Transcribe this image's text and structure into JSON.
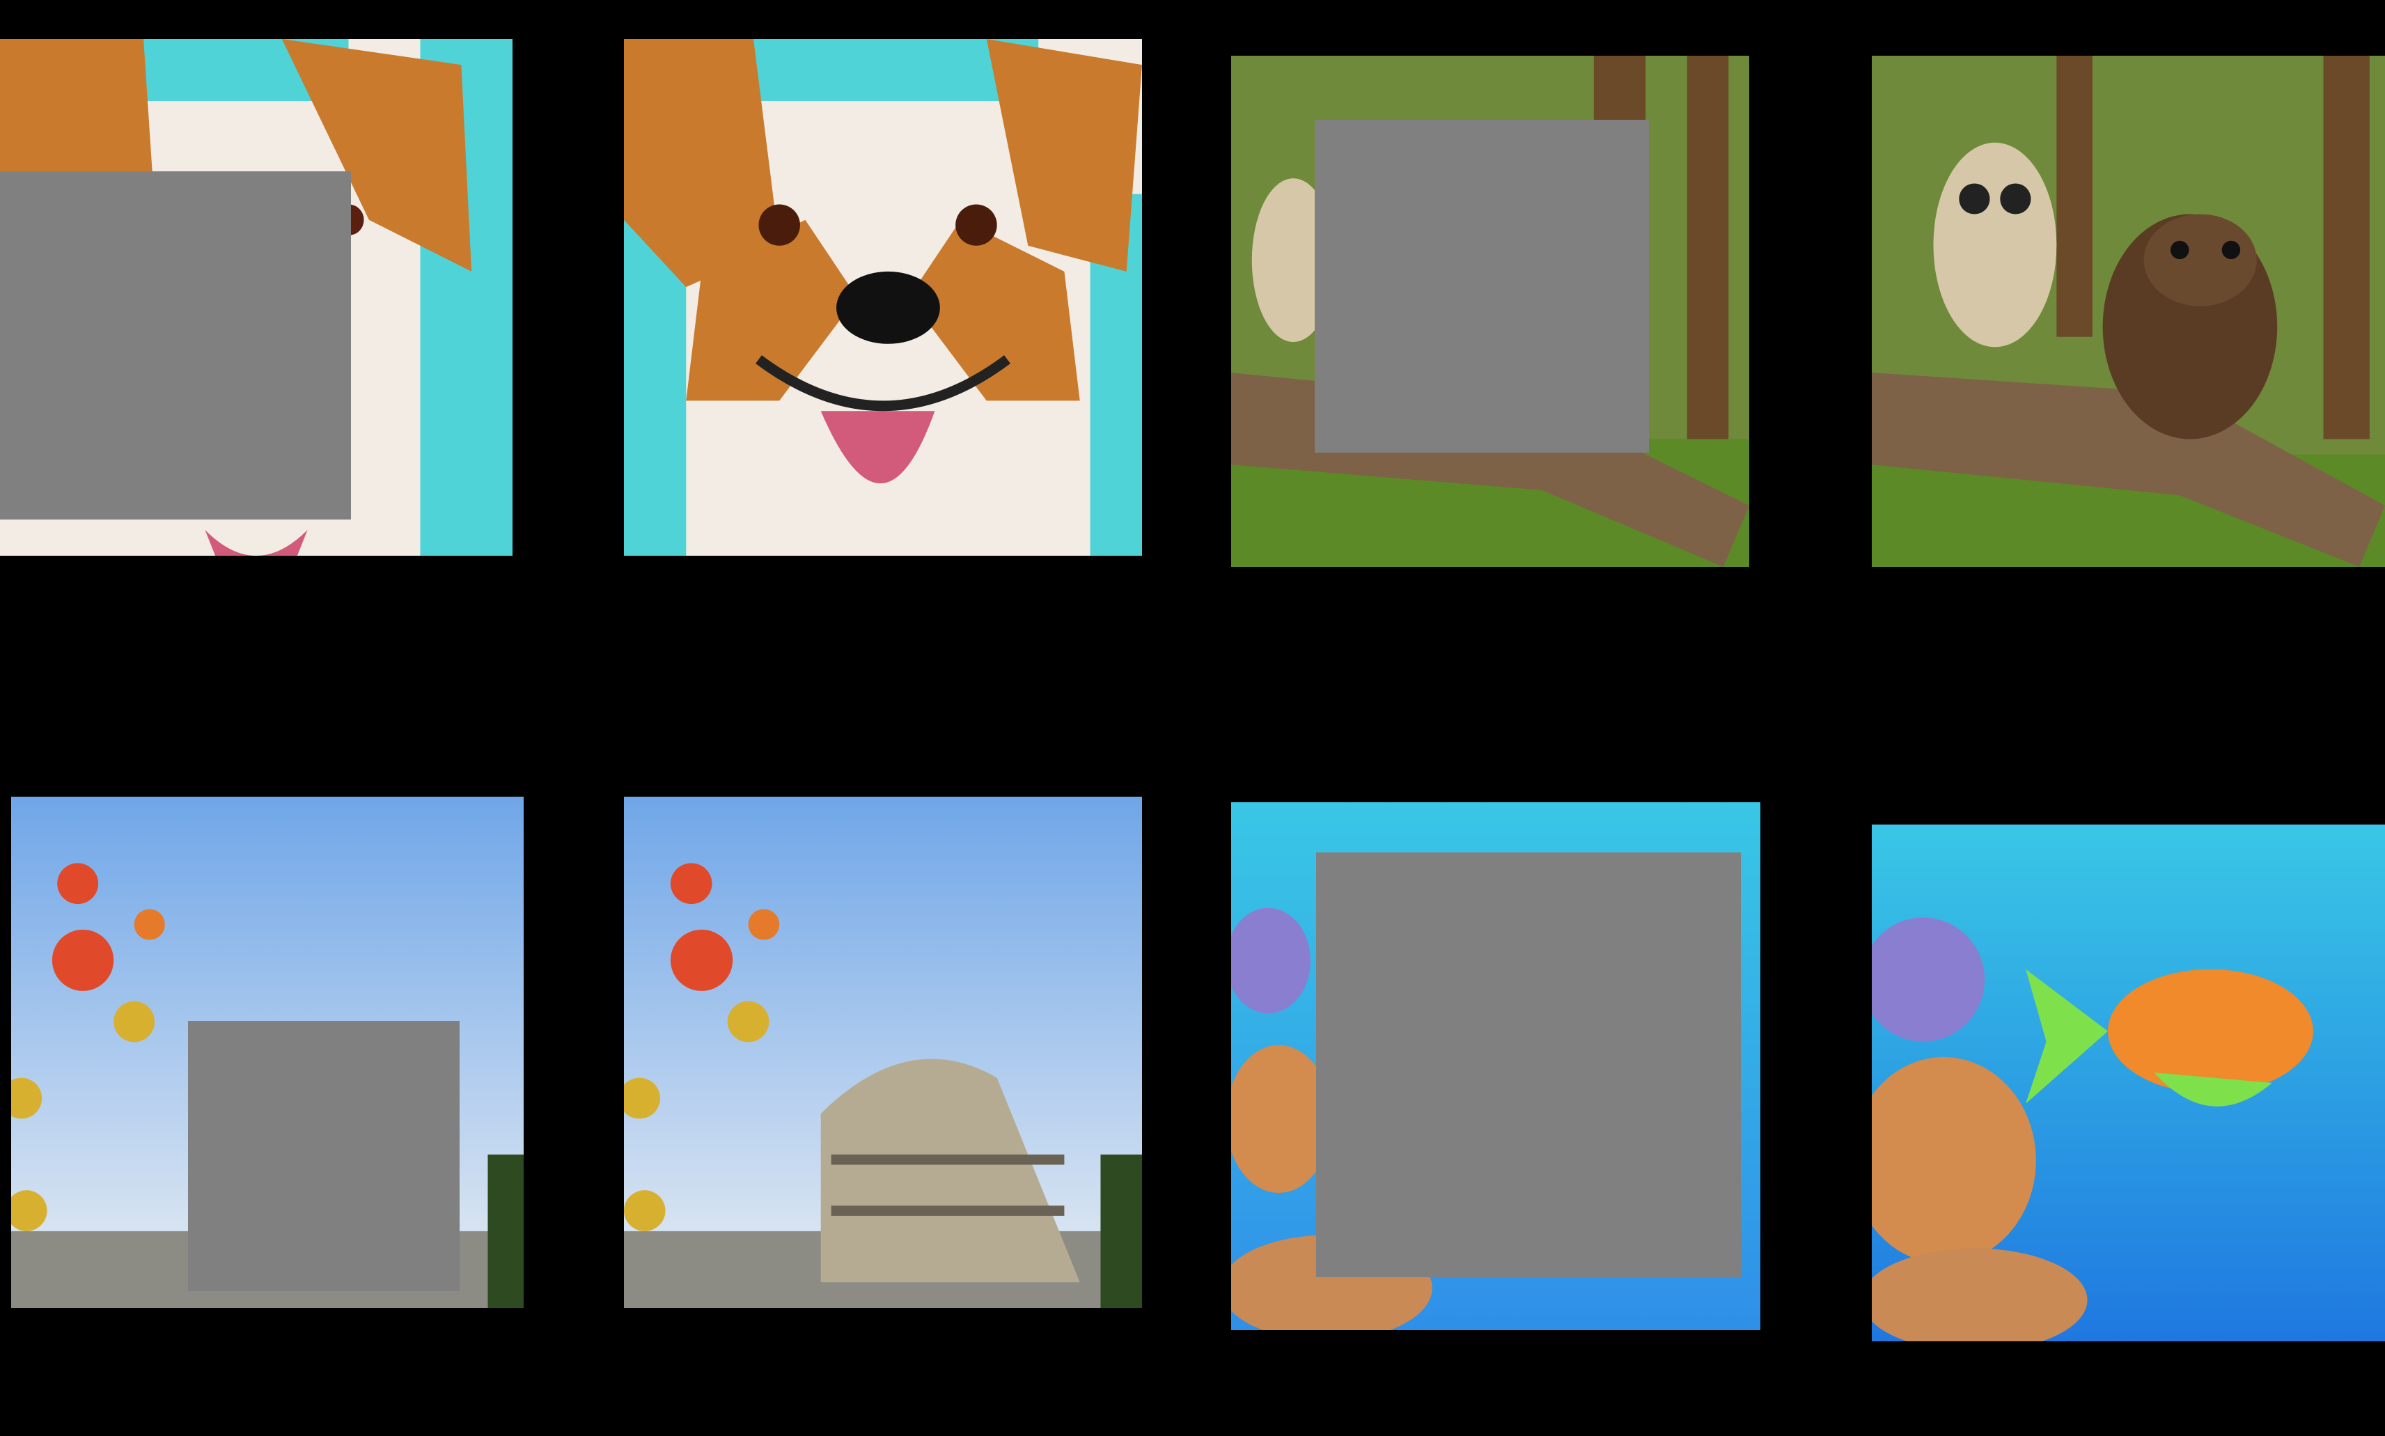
{
  "scene": {
    "background_color": "#000000",
    "mask_color": "#808080",
    "rows": [
      {
        "pairs": [
          {
            "subject": "corgi",
            "masked_variant": true,
            "complete_variant": true
          },
          {
            "subject": "owl-and-beaver-on-branch",
            "masked_variant": true,
            "complete_variant": true
          }
        ]
      },
      {
        "pairs": [
          {
            "subject": "colosseum-with-hot-air-balloons",
            "masked_variant": true,
            "complete_variant": true
          },
          {
            "subject": "tropical-fish-and-coral",
            "masked_variant": true,
            "complete_variant": true
          }
        ]
      }
    ]
  },
  "colors": {
    "corgi_orange": "#c97a2c",
    "corgi_white": "#f3ece4",
    "teal_background": "#4fd3d6",
    "forest_green": "#5c7a2c",
    "sky_blue": "#8fc0ee",
    "water_blue": "#2f8fe8"
  }
}
